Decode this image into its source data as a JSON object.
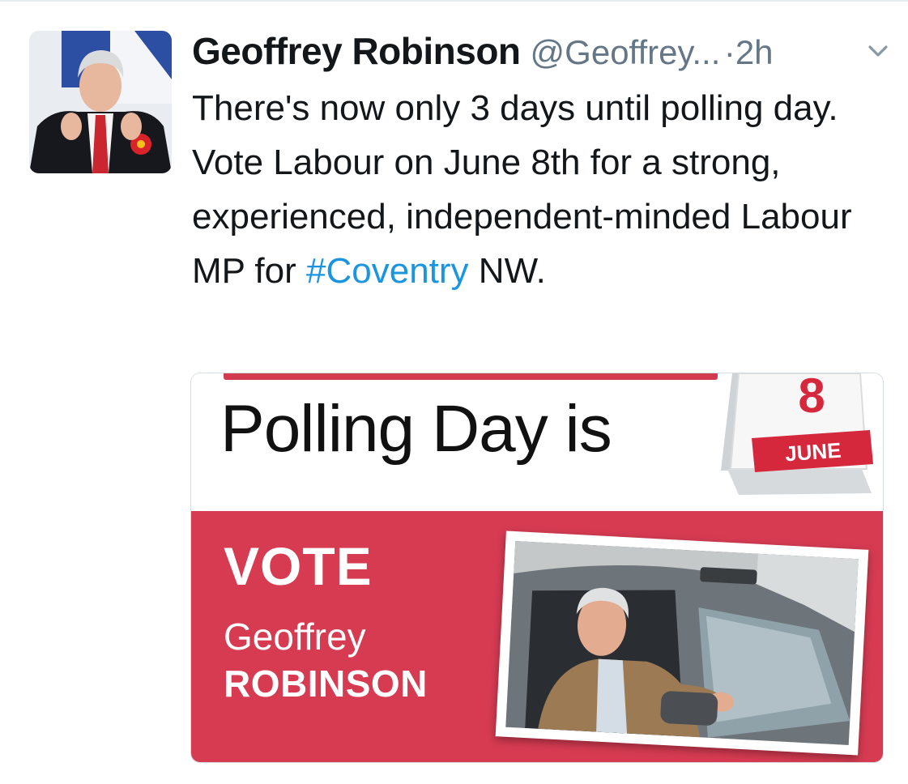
{
  "tweet": {
    "author_name": "Geoffrey Robinson",
    "handle": "@Geoffrey...",
    "separator": "·",
    "time": "2h",
    "text_before": "There's now only 3 days until polling day. Vote Labour on June 8th for a strong, experienced, independent-minded Labour MP for ",
    "hashtag": "#Coventry",
    "text_after": " NW."
  },
  "icons": {
    "avatar": "profile-photo",
    "menu": "chevron-down-icon"
  },
  "poster": {
    "headline": "Polling Day is",
    "calendar_day": "8",
    "calendar_month": "JUNE",
    "vote_label": "VOTE",
    "first_name": "Geoffrey",
    "last_name": "ROBINSON"
  },
  "colors": {
    "hashtag_blue": "#1b95e0",
    "labour_red": "#d63b52",
    "meta_gray": "#657786"
  }
}
